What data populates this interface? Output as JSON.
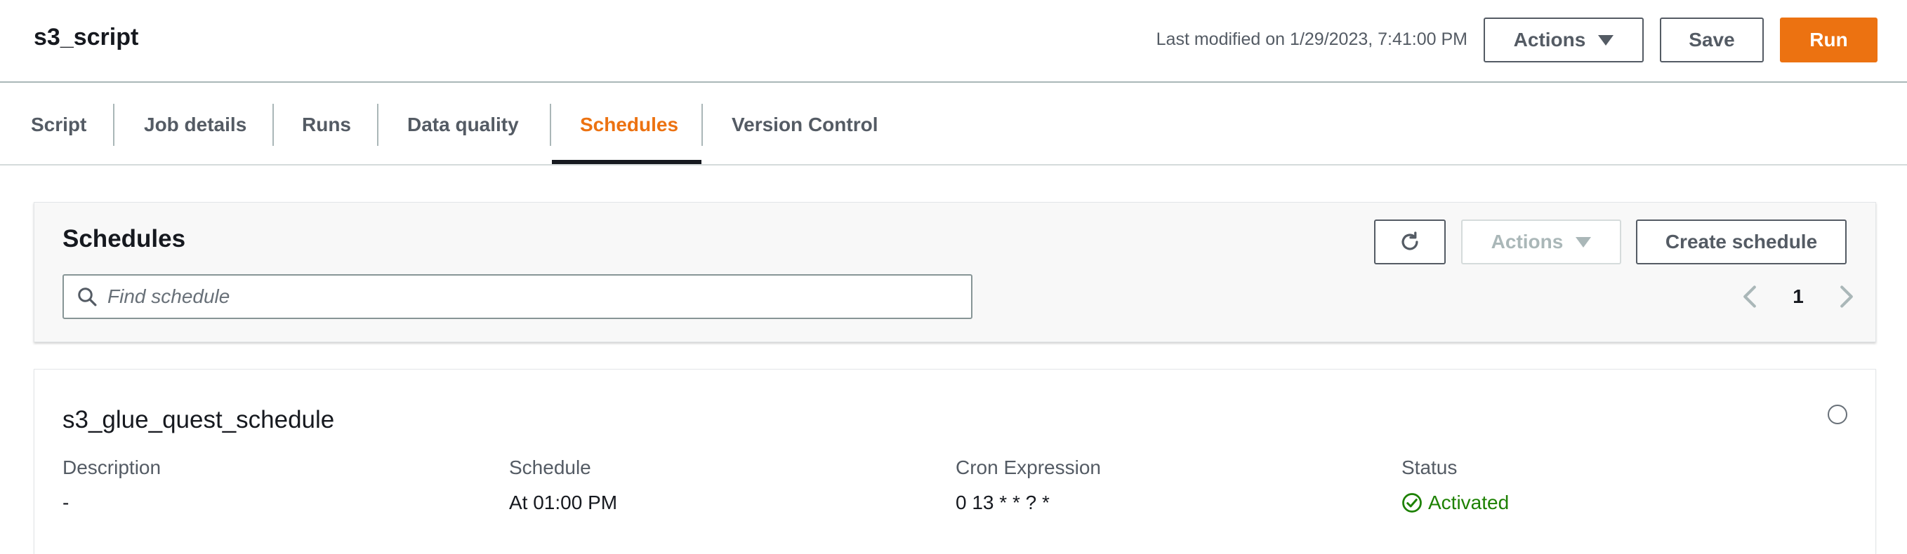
{
  "header": {
    "title": "s3_script",
    "last_modified": "Last modified on 1/29/2023, 7:41:00 PM",
    "actions_label": "Actions",
    "save_label": "Save",
    "run_label": "Run"
  },
  "tabs": [
    {
      "label": "Script"
    },
    {
      "label": "Job details"
    },
    {
      "label": "Runs"
    },
    {
      "label": "Data quality"
    },
    {
      "label": "Schedules",
      "active": true
    },
    {
      "label": "Version Control"
    }
  ],
  "schedules_panel": {
    "title": "Schedules",
    "search_placeholder": "Find schedule",
    "refresh_icon": "refresh-icon",
    "actions_label": "Actions",
    "create_label": "Create schedule",
    "page": "1"
  },
  "schedule": {
    "name": "s3_glue_quest_schedule",
    "columns": [
      {
        "label": "Description",
        "value": "-"
      },
      {
        "label": "Schedule",
        "value": "At 01:00 PM"
      },
      {
        "label": "Cron Expression",
        "value": "0 13 * * ? *"
      },
      {
        "label": "Status",
        "value": "Activated"
      }
    ]
  },
  "colors": {
    "accent": "#ec7211",
    "success": "#1d8102",
    "text": "#16191f",
    "muted": "#545b64"
  }
}
